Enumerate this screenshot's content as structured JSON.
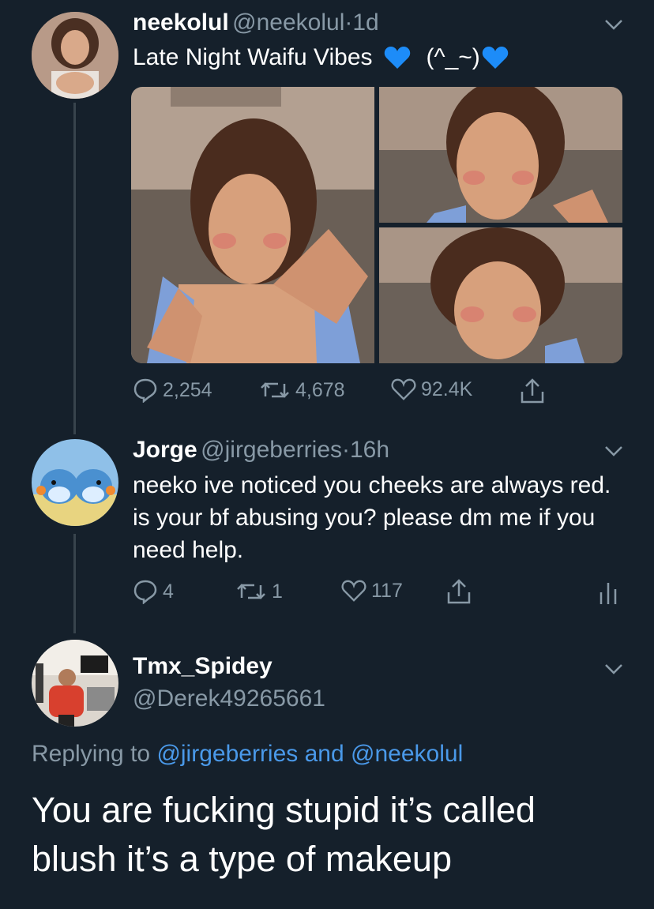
{
  "tweet1": {
    "name": "neekolul",
    "handle": "@neekolul",
    "dot": "·",
    "time": "1d",
    "text": "Late Night Waifu Vibes",
    "emoticon": "(^_~)",
    "emoji": "blue-heart",
    "replies": "2,254",
    "retweets": "4,678",
    "likes": "92.4K"
  },
  "tweet2": {
    "name": "Jorge",
    "handle": "@jirgeberries",
    "dot": "·",
    "time": "16h",
    "text": "neeko ive noticed you cheeks are always red. is your bf abusing you? please dm me if you need help.",
    "replies": "4",
    "retweets": "1",
    "likes": "117"
  },
  "tweet3": {
    "name": "Tmx_Spidey",
    "handle": "@Derek49265661",
    "replying_prefix": "Replying to",
    "replying_user1": "@jirgeberries",
    "replying_and": "and",
    "replying_user2": "@neekolul",
    "text": "You are fucking stupid it’s called blush it’s a type of makeup"
  },
  "colors": {
    "background": "#15202b",
    "muted": "#8899a6",
    "link": "#4a99e9",
    "heart_blue": "#1d8cf8"
  }
}
